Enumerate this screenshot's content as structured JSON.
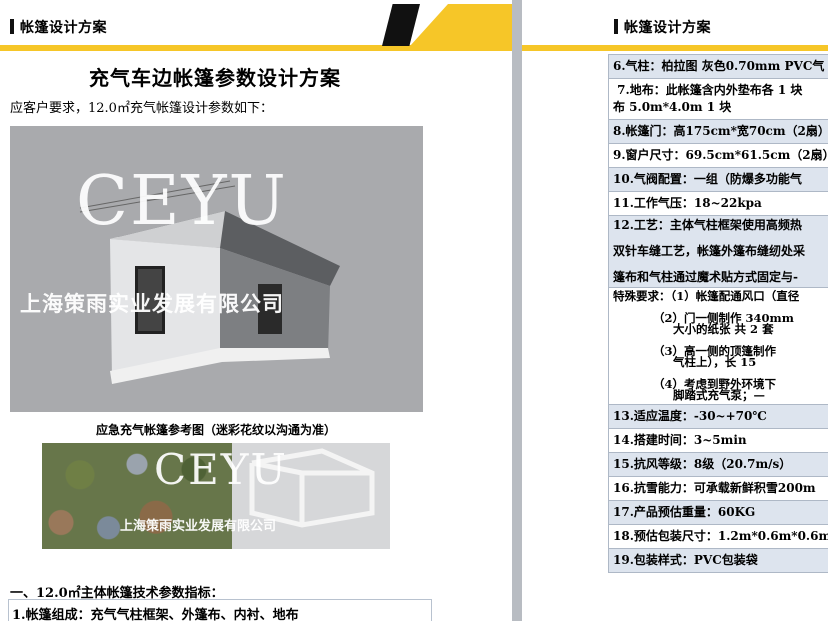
{
  "left_page": {
    "header_title": "帐篷设计方案",
    "doc_title": "充气车边帐篷参数设计方案",
    "intro": "应客户要求，12.0㎡充气帐篷设计参数如下：",
    "watermark_logo": "CEYU",
    "watermark_company": "上海策雨实业发展有限公司",
    "caption": "应急充气帐篷参考图（迷彩花纹以沟通为准）",
    "section_title": "一、12.0㎡主体帐篷技术参数指标：",
    "spec_first": "1.帐篷组成：充气气柱框架、外篷布、内衬、地布"
  },
  "right_page": {
    "header_title": "帐篷设计方案",
    "specs": [
      "6.气柱：柏拉图 灰色0.70mm PVC气",
      " 7.地布：此帐篷含内外垫布各 1 块\n布 5.0m*4.0m 1 块",
      "8.帐篷门：高175cm*宽70cm（2扇）",
      "9.窗户尺寸：69.5cm*61.5cm（2扇）",
      "10.气阀配置：一组（防爆多功能气",
      "11.工作气压：18~22kpa",
      "12.工艺：主体气柱框架使用高频热\n\n双针车缝工艺，帐篷外篷布缝纫处采\n\n篷布和气柱通过魔术贴方式固定与-",
      "特殊要求：（1）帐篷配通风口（直径\n\n          （2）门一侧制作 340mm\n               大小的纸张 共 2 套\n\n          （3）高一侧的顶篷制作\n               气柱上），长 15\n\n          （4）考虑到野外环境下\n               脚踏式充气泵；—",
      "13.适应温度：-30~+70℃",
      "14.搭建时间：3~5min",
      "15.抗风等级：8级（20.7m/s）",
      "16.抗雪能力：可承载新鲜积雪200m",
      "17.产品预估重量：60KG",
      "18.预估包装尺寸：1.2m*0.6m*0.6m",
      "19.包装样式：PVC包装袋"
    ]
  },
  "colors": {
    "accent": "#f6c628",
    "header_bar": "#111111",
    "table_border": "#aeb8c6",
    "table_shade": "#dde4ee"
  }
}
